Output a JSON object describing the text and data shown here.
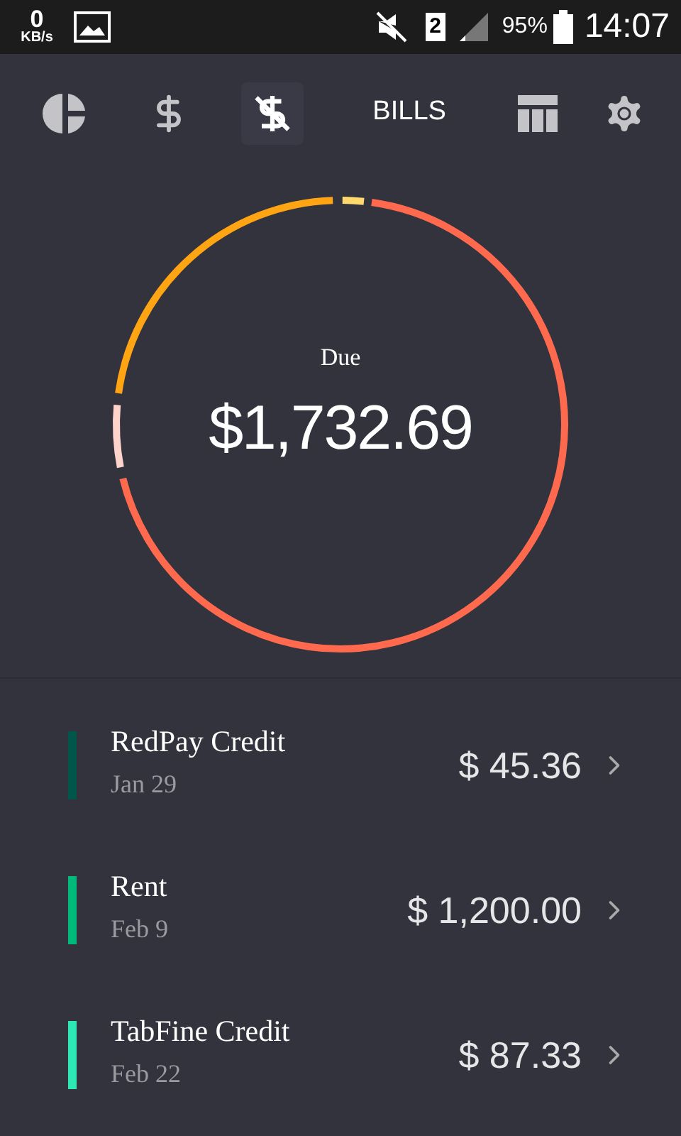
{
  "status_bar": {
    "speed": "0",
    "speed_unit": "KB/s",
    "sim": "2",
    "battery": "95%",
    "time": "14:07"
  },
  "toolbar": {
    "title": "BILLS",
    "tabs": [
      {
        "selected": false
      },
      {
        "selected": false
      },
      {
        "selected": true
      }
    ]
  },
  "summary": {
    "label": "Due",
    "amount": "$1,732.69"
  },
  "bills": [
    {
      "name": "RedPay Credit",
      "date": "Jan 29",
      "amount": "$ 45.36",
      "color": "#00564b"
    },
    {
      "name": "Rent",
      "date": "Feb 9",
      "amount": "$ 1,200.00",
      "color": "#00b97a"
    },
    {
      "name": "TabFine Credit",
      "date": "Feb 22",
      "amount": "$ 87.33",
      "color": "#2de8b5"
    }
  ]
}
